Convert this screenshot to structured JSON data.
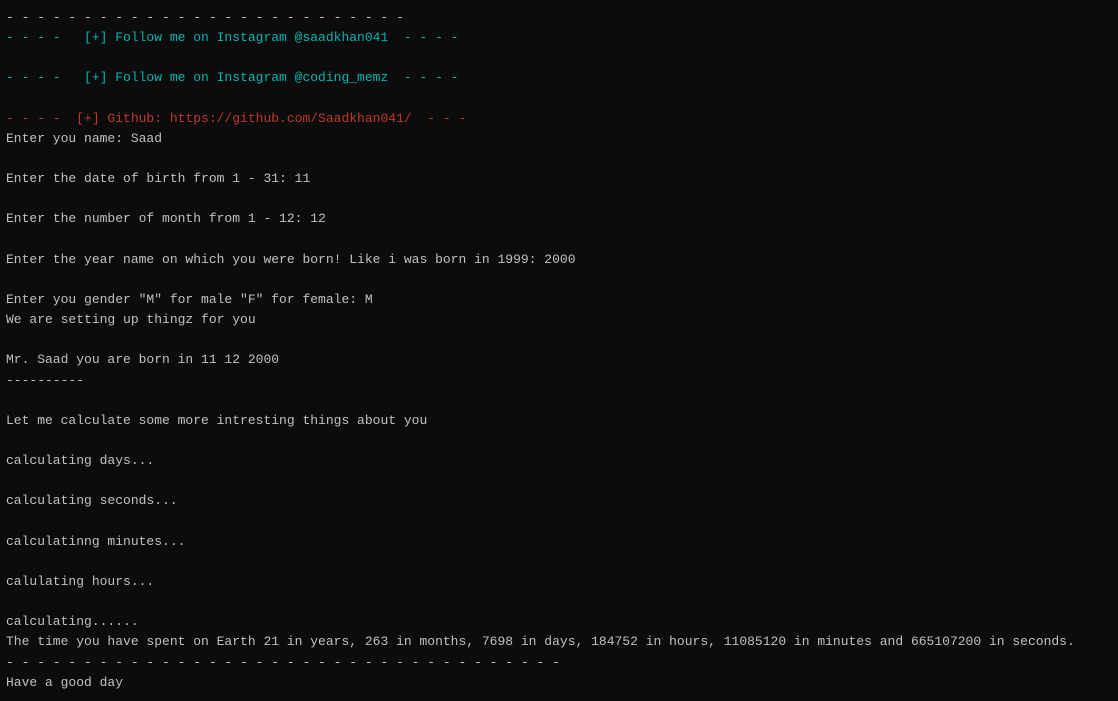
{
  "terminal": {
    "lines": [
      {
        "text": "- - - - - - - - - - - - - - - - - - - - - - - - - - -",
        "color": "white"
      },
      {
        "text": "- - - -   [+] Follow me on Instagram @saadkhan041  - - - -",
        "color": "cyan"
      },
      {
        "text": "",
        "color": "white"
      },
      {
        "text": "- - - -   [+] Follow me on Instagram @coding_memz  - - - -",
        "color": "cyan"
      },
      {
        "text": "",
        "color": "white"
      },
      {
        "text": "- - - -  [+] Github: https://github.com/Saadkhan041/  - - -",
        "color": "red"
      },
      {
        "text": "Enter you name: Saad",
        "color": "white"
      },
      {
        "text": "",
        "color": "white"
      },
      {
        "text": "Enter the date of birth from 1 - 31: 11",
        "color": "white"
      },
      {
        "text": "",
        "color": "white"
      },
      {
        "text": "Enter the number of month from 1 - 12: 12",
        "color": "white"
      },
      {
        "text": "",
        "color": "white"
      },
      {
        "text": "Enter the year name on which you were born! Like i was born in 1999: 2000",
        "color": "white"
      },
      {
        "text": "",
        "color": "white"
      },
      {
        "text": "Enter you gender \"M\" for male \"F\" for female: M",
        "color": "white"
      },
      {
        "text": "We are setting up thingz for you",
        "color": "white"
      },
      {
        "text": "",
        "color": "white"
      },
      {
        "text": "Mr. Saad you are born in 11 12 2000",
        "color": "white"
      },
      {
        "text": "----------",
        "color": "white"
      },
      {
        "text": "",
        "color": "white"
      },
      {
        "text": "Let me calculate some more intresting things about you",
        "color": "white"
      },
      {
        "text": "",
        "color": "white"
      },
      {
        "text": "calculating days...",
        "color": "white"
      },
      {
        "text": "",
        "color": "white"
      },
      {
        "text": "calculating seconds...",
        "color": "white"
      },
      {
        "text": "",
        "color": "white"
      },
      {
        "text": "calculatinng minutes...",
        "color": "white"
      },
      {
        "text": "",
        "color": "white"
      },
      {
        "text": "calulating hours...",
        "color": "white"
      },
      {
        "text": "",
        "color": "white"
      },
      {
        "text": "calculating......",
        "color": "white"
      },
      {
        "text": "The time you have spent on Earth 21 in years, 263 in months, 7698 in days, 184752 in hours, 11085120 in minutes and 665107200 in seconds.",
        "color": "white"
      },
      {
        "text": "- - - - - - - - - - - - - - - - - - - - - - - - - - - - - - - - - - - -",
        "color": "white"
      },
      {
        "text": "Have a good day",
        "color": "white"
      }
    ]
  }
}
